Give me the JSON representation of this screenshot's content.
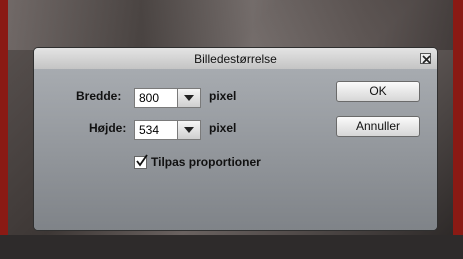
{
  "dialog": {
    "title": "Billedestørrelse",
    "width_label": "Bredde:",
    "width_value": "800",
    "height_label": "Højde:",
    "height_value": "534",
    "unit_width": "pixel",
    "unit_height": "pixel",
    "constrain_label": "Tilpas proportioner",
    "constrain_checked": true,
    "ok_label": "OK",
    "cancel_label": "Annuller"
  },
  "icons": {
    "close": "close-icon",
    "dropdown": "chevron-down-icon",
    "check": "checkmark-icon"
  },
  "colors": {
    "frame_red": "#8a1a14",
    "dialog_bg": "#8d9196",
    "titlebar": "#d4d4d4"
  }
}
